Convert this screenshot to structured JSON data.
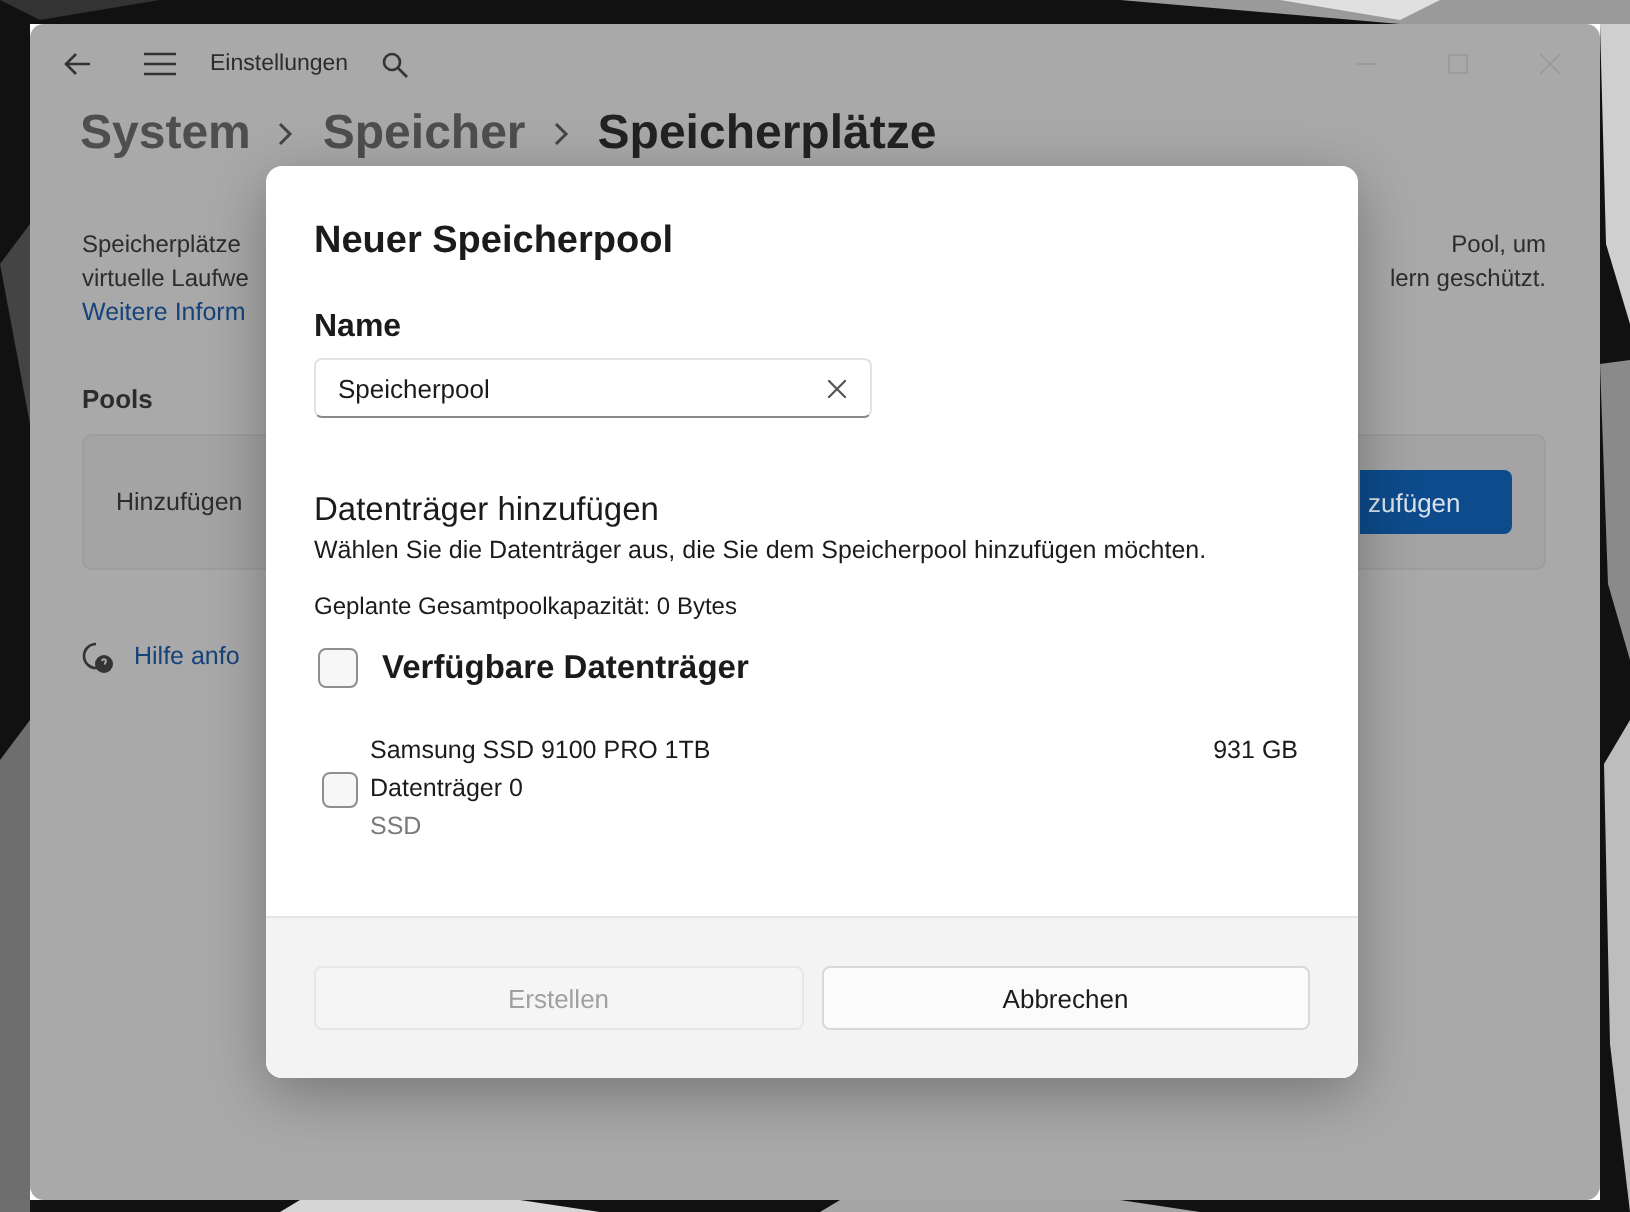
{
  "window": {
    "title": "Einstellungen"
  },
  "breadcrumb": [
    "System",
    "Speicher",
    "Speicherplätze"
  ],
  "background": {
    "description_left": [
      "Speicherplätze",
      "virtuelle Laufwe"
    ],
    "description_right": [
      "Pool, um",
      "lern geschützt."
    ],
    "link": "Weitere Inform",
    "pools_heading": "Pools",
    "card_label": "Hinzufügen",
    "card_button": "zufügen",
    "help_link": "Hilfe anfo"
  },
  "dialog": {
    "title": "Neuer Speicherpool",
    "name_field": {
      "label": "Name",
      "value": "Speicherpool"
    },
    "section": {
      "heading": "Datenträger hinzufügen",
      "description": "Wählen Sie die Datenträger aus, die Sie dem Speicherpool hinzufügen möchten.",
      "capacity": "Geplante Gesamtpoolkapazität: 0 Bytes"
    },
    "select_all": {
      "label": "Verfügbare Datenträger",
      "checked": false
    },
    "disks": [
      {
        "name": "Samsung SSD 9100 PRO 1TB",
        "number": "Datenträger 0",
        "type": "SSD",
        "size": "931 GB",
        "checked": false
      }
    ],
    "buttons": [
      {
        "label": "Erstellen",
        "disabled": true
      },
      {
        "label": "Abbrechen",
        "disabled": false
      }
    ]
  }
}
